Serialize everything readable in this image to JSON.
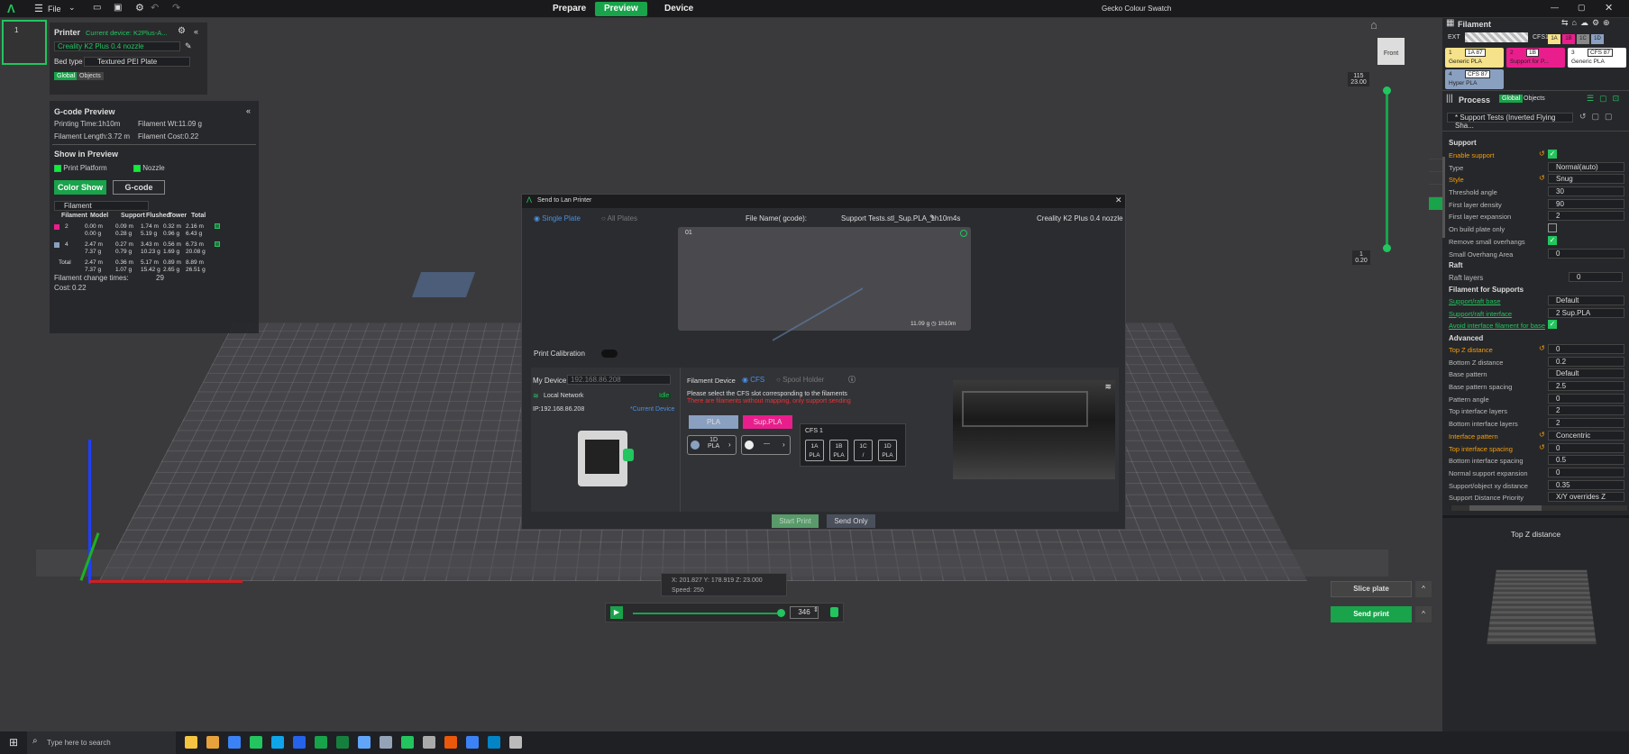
{
  "topbar": {
    "file": "File",
    "tabs": [
      "Prepare",
      "Preview",
      "Device"
    ],
    "title": "Gecko Colour Swatch"
  },
  "printer": {
    "label": "Printer",
    "current_device": "Current device: K2Plus-A...",
    "nozzle": "Creality K2 Plus 0.4 nozzle",
    "bed_type_label": "Bed type",
    "bed_type": "Textured PEI Plate",
    "global": "Global",
    "objects": "Objects",
    "plate_num": "1"
  },
  "gcode": {
    "title": "G-code Preview",
    "printing_time": "Printing Time:1h10m",
    "filament_wt": "Filament Wt:11.09 g",
    "filament_length": "Filament Length:3.72 m",
    "filament_cost": "Filament Cost:0.22",
    "show_in_preview": "Show in Preview",
    "print_platform": "Print Platform",
    "nozzle": "Nozzle",
    "color_show": "Color Show",
    "gcode_btn": "G-code",
    "filament_dd": "Filament",
    "headers": [
      "Filament",
      "Model",
      "Support",
      "Flushed",
      "Tower",
      "Total"
    ],
    "rows": [
      {
        "id": "2",
        "color": "#e91e8c",
        "model": "0.00 m\n0.00 g",
        "support": "0.09 m\n0.28 g",
        "flushed": "1.74 m\n5.19 g",
        "tower": "0.32 m\n0.96 g",
        "total": "2.16 m\n6.43 g"
      },
      {
        "id": "4",
        "color": "#8aa0c0",
        "model": "2.47 m\n7.37 g",
        "support": "0.27 m\n0.79 g",
        "flushed": "3.43 m\n10.23 g",
        "tower": "0.56 m\n1.69 g",
        "total": "6.73 m\n20.08 g"
      },
      {
        "id": "Total",
        "color": "",
        "model": "2.47 m\n7.37 g",
        "support": "0.36 m\n1.07 g",
        "flushed": "5.17 m\n15.42 g",
        "tower": "0.89 m\n2.65 g",
        "total": "8.89 m\n26.51 g"
      }
    ],
    "change_times": "Filament change times:",
    "change_val": "29",
    "cost": "Cost:",
    "cost_val": "0.22"
  },
  "dialog": {
    "title": "Send to Lan Printer",
    "single_plate": "Single Plate",
    "all_plates": "All Plates",
    "file_name_label": "File Name( gcode):",
    "file_name": "Support Tests.stl_Sup.PLA_1h10m4s",
    "printer_model": "Creality K2 Plus 0.4 nozzle",
    "plate_num": "01",
    "plate_stats": "11.09 g ◷ 1h10m",
    "print_calibration": "Print Calibration",
    "my_device": "My Device",
    "device_ip_dd": "192.168.86.208",
    "local_network": "Local Network",
    "idle": "Idle",
    "ip": "IP:192.168.86.208",
    "current_device": "*Current Device",
    "filament_device": "Filament Device",
    "cfs": "CFS",
    "spool_holder": "Spool Holder",
    "select_msg": "Please select the CFS slot corresponding to the filaments",
    "warn_msg": "There are filaments without mapping, only support sending",
    "pla": "PLA",
    "sup_pla": "Sup.PLA",
    "slot_a": "1D\nPLA",
    "slot_b": "—",
    "cfs1": "CFS 1",
    "cfs_slots": [
      {
        "id": "1A",
        "mat": "PLA"
      },
      {
        "id": "1B",
        "mat": "PLA"
      },
      {
        "id": "1C",
        "mat": "/"
      },
      {
        "id": "1D",
        "mat": "PLA"
      }
    ],
    "start_print": "Start Print",
    "send_only": "Send Only"
  },
  "right": {
    "filament": "Filament",
    "ext": "EXT",
    "cfs1": "CFS1",
    "tags": [
      "1A",
      "1B",
      "1C",
      "1D"
    ],
    "slots": [
      {
        "n": "1",
        "tag": "1A 87",
        "name": "Generic PLA",
        "color": "#f5e28a"
      },
      {
        "n": "2",
        "tag": "1B",
        "name": "Support for P...",
        "color": "#e91e8c"
      },
      {
        "n": "3",
        "tag": "CFS 87",
        "name": "Generic PLA",
        "color": "#ffffff"
      },
      {
        "n": "4",
        "tag": "CFS 87",
        "name": "Hyper PLA",
        "color": "#8aa0c0"
      }
    ],
    "process": "Process",
    "global": "Global",
    "objects": "Objects",
    "profile": "* Support Tests (Inverted Flying Sha...",
    "support": "Support",
    "params": [
      {
        "label": "Enable support",
        "val": "",
        "type": "check",
        "hl": true
      },
      {
        "label": "Type",
        "val": "Normal(auto)",
        "type": "dd"
      },
      {
        "label": "Style",
        "val": "Snug",
        "type": "dd",
        "hl": true
      },
      {
        "label": "Threshold angle",
        "val": "30",
        "type": "num"
      },
      {
        "label": "First layer density",
        "val": "90",
        "type": "num"
      },
      {
        "label": "First layer expansion",
        "val": "2",
        "type": "num"
      },
      {
        "label": "On build plate only",
        "val": "",
        "type": "uncheck"
      },
      {
        "label": "Remove small overhangs",
        "val": "",
        "type": "check"
      },
      {
        "label": "Small Overhang Area",
        "val": "0",
        "type": "num"
      }
    ],
    "raft": "Raft",
    "raft_layers": "Raft layers",
    "raft_layers_val": "0",
    "ffs": "Filament for Supports",
    "ffs_params": [
      {
        "label": "Support/raft base",
        "val": "Default",
        "type": "dd",
        "link": true
      },
      {
        "label": "Support/raft interface",
        "val": "2 Sup.PLA",
        "type": "dd",
        "link": true
      },
      {
        "label": "Avoid interface filament for base",
        "val": "",
        "type": "check",
        "link": true
      }
    ],
    "advanced": "Advanced",
    "adv_params": [
      {
        "label": "Top Z distance",
        "val": "0",
        "hl": true
      },
      {
        "label": "Bottom Z distance",
        "val": "0.2"
      },
      {
        "label": "Base pattern",
        "val": "Default"
      },
      {
        "label": "Base pattern spacing",
        "val": "2.5"
      },
      {
        "label": "Pattern angle",
        "val": "0"
      },
      {
        "label": "Top interface layers",
        "val": "2"
      },
      {
        "label": "Bottom interface layers",
        "val": "2"
      },
      {
        "label": "Interface pattern",
        "val": "Concentric",
        "hl": true
      },
      {
        "label": "Top interface spacing",
        "val": "0",
        "hl": true
      },
      {
        "label": "Bottom interface spacing",
        "val": "0.5"
      },
      {
        "label": "Normal support expansion",
        "val": "0"
      },
      {
        "label": "Support/object xy distance",
        "val": "0.35"
      },
      {
        "label": "Support Distance Priority",
        "val": "X/Y overrides Z"
      }
    ],
    "preview_title": "Top Z distance"
  },
  "viewport": {
    "front": "Front",
    "layer_top": "115\n23.00",
    "layer_bottom": "1\n0.20",
    "coords": "X: 201.827  Y: 178.919  Z: 23.000",
    "speed": "Speed: 250",
    "layer_val": "346",
    "slice_plate": "Slice plate",
    "send_print": "Send print"
  },
  "taskbar": {
    "search": "Type here to search"
  }
}
